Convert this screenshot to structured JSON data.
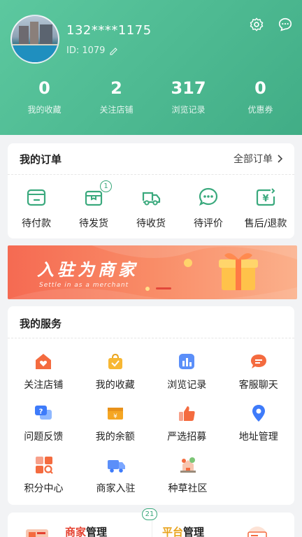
{
  "profile": {
    "phone": "132****1175",
    "id_text": "ID: 1079",
    "icons": [
      "settings-icon",
      "message-icon",
      "edit-icon"
    ]
  },
  "stats": [
    {
      "value": "0",
      "label": "我的收藏"
    },
    {
      "value": "2",
      "label": "关注店铺"
    },
    {
      "value": "317",
      "label": "浏览记录"
    },
    {
      "value": "0",
      "label": "优惠券"
    }
  ],
  "orders": {
    "title": "我的订单",
    "all_label": "全部订单",
    "items": [
      {
        "label": "待付款",
        "icon": "wallet-icon",
        "badge": ""
      },
      {
        "label": "待发货",
        "icon": "package-icon",
        "badge": "1"
      },
      {
        "label": "待收货",
        "icon": "truck-icon",
        "badge": ""
      },
      {
        "label": "待评价",
        "icon": "comment-icon",
        "badge": ""
      },
      {
        "label": "售后/退款",
        "icon": "refund-icon",
        "badge": ""
      }
    ]
  },
  "banner": {
    "title": "入驻为商家",
    "subtitle": "Settle in as a merchant"
  },
  "services": {
    "title": "我的服务",
    "items": [
      {
        "label": "关注店铺",
        "icon": "shop-heart-icon"
      },
      {
        "label": "我的收藏",
        "icon": "favorite-bag-icon"
      },
      {
        "label": "浏览记录",
        "icon": "history-chart-icon"
      },
      {
        "label": "客服聊天",
        "icon": "chat-icon"
      },
      {
        "label": "问题反馈",
        "icon": "feedback-icon"
      },
      {
        "label": "我的余额",
        "icon": "balance-icon"
      },
      {
        "label": "严选招募",
        "icon": "thumbs-up-icon"
      },
      {
        "label": "地址管理",
        "icon": "location-icon"
      },
      {
        "label": "积分中心",
        "icon": "points-grid-icon"
      },
      {
        "label": "商家入驻",
        "icon": "delivery-truck-icon"
      },
      {
        "label": "种草社区",
        "icon": "community-icon"
      }
    ]
  },
  "bottom": {
    "badge": "21",
    "left_accent": "商家",
    "left_rest": "管理",
    "right_accent": "平台",
    "right_rest": "管理"
  },
  "colors": {
    "brand": "#4fb88f",
    "icon_green": "#3aa97d",
    "accent_red": "#e5402f",
    "accent_orange": "#e8a21a"
  }
}
